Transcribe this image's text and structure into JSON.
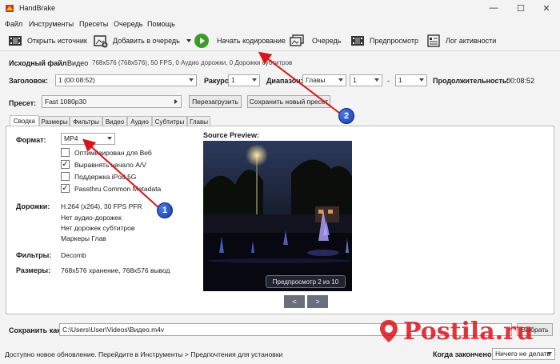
{
  "window": {
    "title": "HandBrake",
    "controls": {
      "minimize": "—",
      "maximize": "☐",
      "close": "✕"
    }
  },
  "menu": [
    "Файл",
    "Инструменты",
    "Пресеты",
    "Очередь",
    "Помощь"
  ],
  "toolbar": {
    "open_source": "Открыть источник",
    "add_to_queue": "Добавить в очередь",
    "start_encode": "Начать кодирование",
    "queue": "Очередь",
    "preview": "Предпросмотр",
    "activity_log": "Лог активности"
  },
  "source": {
    "label": "Исходный файл:",
    "name": "Видео",
    "info": "768x576 (768x576), 50 FPS, 0 Аудио дорожки, 0 Дорожки субтитров"
  },
  "title_row": {
    "title_label": "Заголовок:",
    "title_value": "1 (00:08:52)",
    "angle_label": "Ракурс:",
    "angle_value": "1",
    "range_label": "Диапазон:",
    "range_type": "Главы",
    "range_from": "1",
    "range_dash": "-",
    "range_to": "1",
    "duration_label": "Продолжительность:",
    "duration_value": "00:08:52"
  },
  "preset": {
    "label": "Пресет:",
    "value": "Fast 1080p30",
    "reload": "Перезагрузить",
    "save_new": "Сохранить новый пресет"
  },
  "tabs": [
    "Сводка",
    "Размеры",
    "Фильтры",
    "Видео",
    "Аудио",
    "Субтитры",
    "Главы"
  ],
  "summary": {
    "format_label": "Формат:",
    "format_value": "MP4",
    "options": [
      {
        "label": "Оптимизирован для Веб",
        "checked": false
      },
      {
        "label": "Выравнять начало A/V",
        "checked": true
      },
      {
        "label": "Поддержка iPod 5G",
        "checked": false
      },
      {
        "label": "Passthru Common Metadata",
        "checked": true
      }
    ],
    "tracks_label": "Дорожки:",
    "tracks": [
      "H.264 (x264), 30 FPS PFR",
      "Нет аудио-дорожек",
      "Нет дорожек субтитров",
      "Маркеры Глав"
    ],
    "filters_label": "Фильтры:",
    "filters_value": "Decomb",
    "sizes_label": "Размеры:",
    "sizes_value": "768x576 хранение, 768x576 вывод",
    "preview_title": "Source Preview:",
    "preview_caption": "Предпросмотр 2 из 10",
    "prev": "<",
    "next": ">"
  },
  "save": {
    "label": "Сохранить как:",
    "path": "C:\\Users\\User\\Videos\\Видео.m4v",
    "browse": "Выбрать"
  },
  "status": {
    "message": "Доступно новое обновление. Перейдите в Инструменты > Предпочтения для установки",
    "when_done_label": "Когда закончено:",
    "when_done_value": "Ничего не делать"
  },
  "annotations": [
    "1",
    "2"
  ],
  "watermark": "Postila.ru",
  "colors": {
    "accent_red": "#d9141b",
    "marker_blue": "#1f4fc8",
    "play_green": "#3a9a2a"
  }
}
